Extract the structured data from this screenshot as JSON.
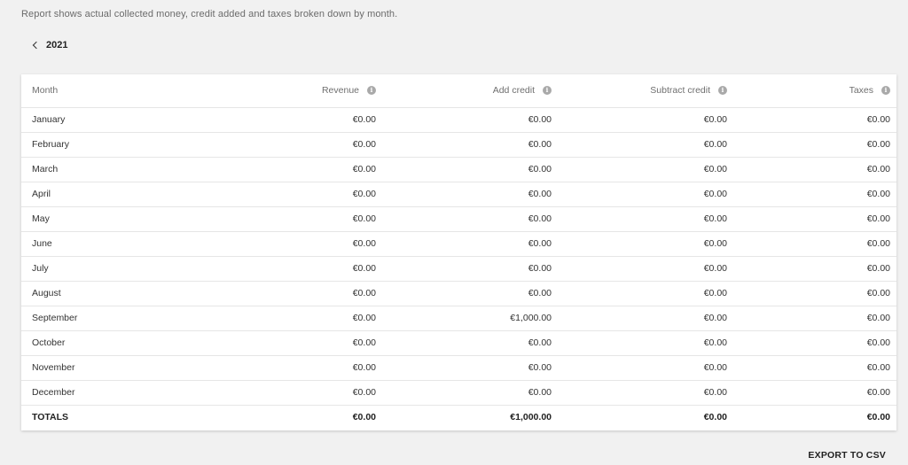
{
  "description": "Report shows actual collected money, credit added and taxes broken down by month.",
  "year_nav": {
    "year": "2021",
    "prev_icon": "chevron-left-icon"
  },
  "table": {
    "headers": [
      "Month",
      "Revenue",
      "Add credit",
      "Subtract credit",
      "Taxes"
    ],
    "info_icon": "info-icon",
    "rows": [
      [
        "January",
        "€0.00",
        "€0.00",
        "€0.00",
        "€0.00"
      ],
      [
        "February",
        "€0.00",
        "€0.00",
        "€0.00",
        "€0.00"
      ],
      [
        "March",
        "€0.00",
        "€0.00",
        "€0.00",
        "€0.00"
      ],
      [
        "April",
        "€0.00",
        "€0.00",
        "€0.00",
        "€0.00"
      ],
      [
        "May",
        "€0.00",
        "€0.00",
        "€0.00",
        "€0.00"
      ],
      [
        "June",
        "€0.00",
        "€0.00",
        "€0.00",
        "€0.00"
      ],
      [
        "July",
        "€0.00",
        "€0.00",
        "€0.00",
        "€0.00"
      ],
      [
        "August",
        "€0.00",
        "€0.00",
        "€0.00",
        "€0.00"
      ],
      [
        "September",
        "€0.00",
        "€1,000.00",
        "€0.00",
        "€0.00"
      ],
      [
        "October",
        "€0.00",
        "€0.00",
        "€0.00",
        "€0.00"
      ],
      [
        "November",
        "€0.00",
        "€0.00",
        "€0.00",
        "€0.00"
      ],
      [
        "December",
        "€0.00",
        "€0.00",
        "€0.00",
        "€0.00"
      ]
    ],
    "totals": [
      "TOTALS",
      "€0.00",
      "€1,000.00",
      "€0.00",
      "€0.00"
    ]
  },
  "export_label": "EXPORT TO CSV"
}
